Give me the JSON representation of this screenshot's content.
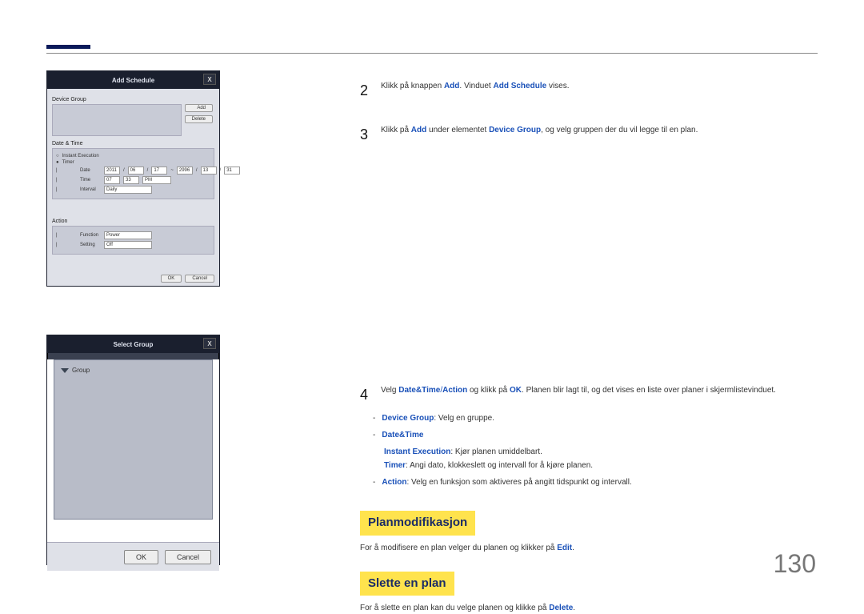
{
  "page_number": "130",
  "shot1": {
    "title": "Add Schedule",
    "close": "X",
    "device_group_lbl": "Device Group",
    "add_btn": "Add",
    "delete_btn": "Delete",
    "dt_lbl": "Date & Time",
    "instant_lbl": "Instant Execution",
    "timer_lbl": "Timer",
    "date_lbl": "Date",
    "date_from_y": "2011",
    "date_from_m": "06",
    "date_from_d": "17",
    "date_to_y": "2996",
    "date_to_m": "13",
    "date_to_d": "31",
    "time_lbl": "Time",
    "time_h": "07",
    "time_m": "33",
    "time_ampm": "PM",
    "interval_lbl": "Interval",
    "interval_val": "Daily",
    "action_lbl": "Action",
    "function_lbl": "Function",
    "function_val": "Power",
    "setting_lbl": "Setting",
    "setting_val": "Off",
    "ok": "OK",
    "cancel": "Cancel"
  },
  "shot2": {
    "title": "Select Group",
    "close": "X",
    "group_lbl": "Group",
    "ok": "OK",
    "cancel": "Cancel"
  },
  "steps": {
    "s2_num": "2",
    "s2_a": "Klikk på knappen ",
    "s2_b": "Add",
    "s2_c": ". Vinduet ",
    "s2_d": "Add Schedule",
    "s2_e": " vises.",
    "s3_num": "3",
    "s3_a": "Klikk på ",
    "s3_b": "Add",
    "s3_c": " under elementet ",
    "s3_d": "Device Group",
    "s3_e": ", og velg gruppen der du vil legge til en plan.",
    "s4_num": "4",
    "s4_a": "Velg ",
    "s4_b": "Date&Time",
    "s4_c": "/",
    "s4_d": "Action",
    "s4_e": " og klikk på ",
    "s4_f": "OK",
    "s4_g": ". Planen blir lagt til, og det vises en liste over planer i skjermlistevinduet.",
    "b1_lbl": "Device Group",
    "b1_txt": ": Velg en gruppe.",
    "b2_lbl": "Date&Time",
    "b2a_lbl": "Instant Execution",
    "b2a_txt": ": Kjør planen umiddelbart.",
    "b2b_lbl": "Timer",
    "b2b_txt": ": Angi dato, klokkeslett og intervall for å kjøre planen.",
    "b3_lbl": "Action",
    "b3_txt": ": Velg en funksjon som aktiveres på angitt tidspunkt og intervall."
  },
  "h_mod": "Planmodifikasjon",
  "p_mod_a": "For å modifisere en plan velger du planen og klikker på ",
  "p_mod_b": "Edit",
  "p_mod_c": ".",
  "h_del": "Slette en plan",
  "p_del_a": "For å slette en plan kan du velge planen og klikke på ",
  "p_del_b": "Delete",
  "p_del_c": "."
}
